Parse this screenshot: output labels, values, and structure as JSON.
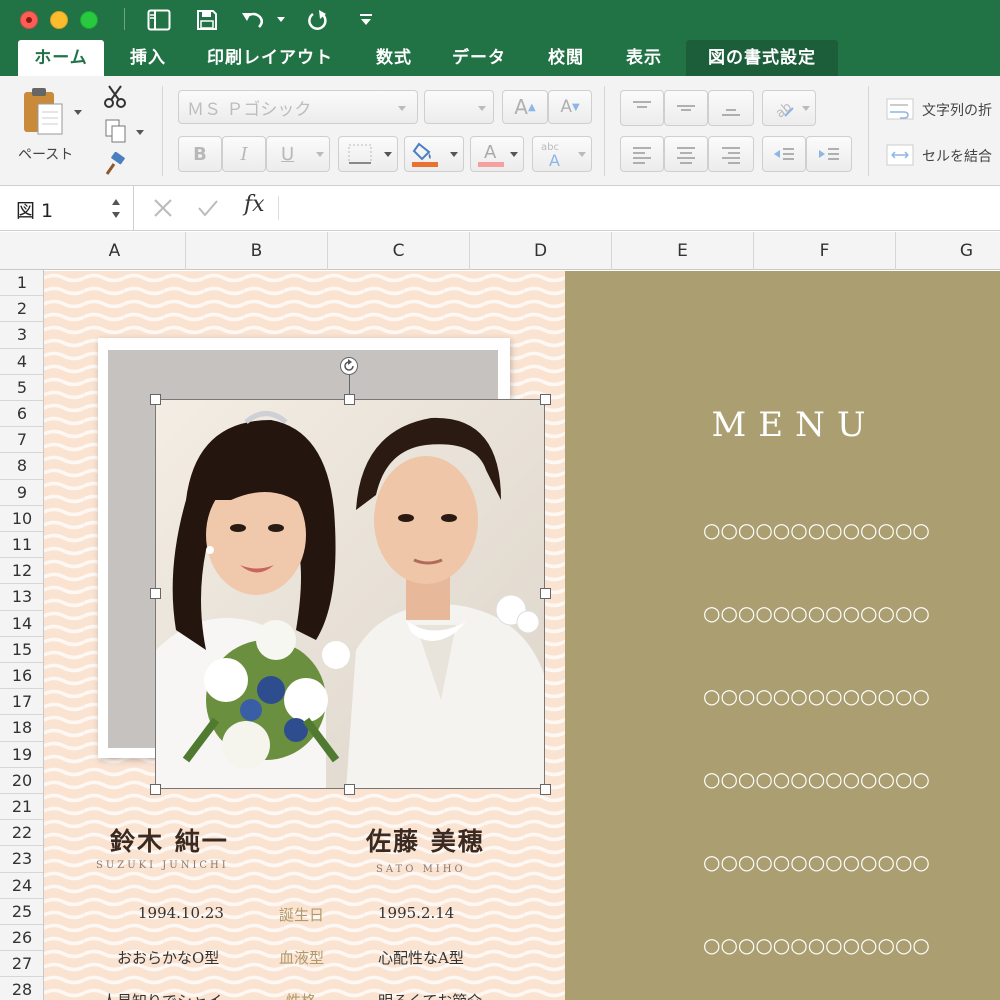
{
  "ribbon_tabs": [
    {
      "label": "ホーム"
    },
    {
      "label": "挿入"
    },
    {
      "label": "印刷レイアウト"
    },
    {
      "label": "数式"
    },
    {
      "label": "データ"
    },
    {
      "label": "校閲"
    },
    {
      "label": "表示"
    },
    {
      "label": "図の書式設定"
    }
  ],
  "ribbon": {
    "paste_label": "ペースト",
    "font_name": "ＭＳ Ｐゴシック",
    "wrap_text_label": "文字列の折",
    "merge_label": "セルを結合"
  },
  "formula_bar": {
    "name_box": "図 1",
    "fx_label": "fx"
  },
  "columns": [
    "A",
    "B",
    "C",
    "D",
    "E",
    "F",
    "G"
  ],
  "rows": [
    "1",
    "2",
    "3",
    "4",
    "5",
    "6",
    "7",
    "8",
    "9",
    "10",
    "11",
    "12",
    "13",
    "14",
    "15",
    "16",
    "17",
    "18",
    "19",
    "20",
    "21",
    "22",
    "23",
    "24",
    "25",
    "26",
    "27",
    "28"
  ],
  "document": {
    "groom_name": "鈴木 純一",
    "groom_romaji": "SUZUKI JUNICHI",
    "bride_name": "佐藤 美穂",
    "bride_romaji": "SATO MIHO",
    "profile_rows": [
      {
        "left": "1994.10.23",
        "label": "誕生日",
        "right": "1995.2.14"
      },
      {
        "left": "おおらかなO型",
        "label": "血液型",
        "right": "心配性なA型"
      },
      {
        "left": "人見知りでシャイ",
        "label": "性格",
        "right": "明るくてお節介"
      }
    ],
    "menu_title": "MENU",
    "menu_items": [
      "○○○○○○○○○○○○○",
      "○○○○○○○○○○○○○",
      "○○○○○○○○○○○○○",
      "○○○○○○○○○○○○○",
      "○○○○○○○○○○○○○",
      "○○○○○○○○○○○○○"
    ]
  },
  "colors": {
    "excel_green": "#217346",
    "left_panel_bg": "#fbe3d2",
    "menu_panel_bg": "#ab9f72",
    "fill_color": "#e97132",
    "font_color": "#f4a0a0"
  },
  "icons": [
    "close-window",
    "minimize-window",
    "zoom-window",
    "save-icon",
    "undo-icon",
    "redo-icon",
    "paste-icon",
    "scissors-icon",
    "copy-icon",
    "format-painter-icon"
  ]
}
